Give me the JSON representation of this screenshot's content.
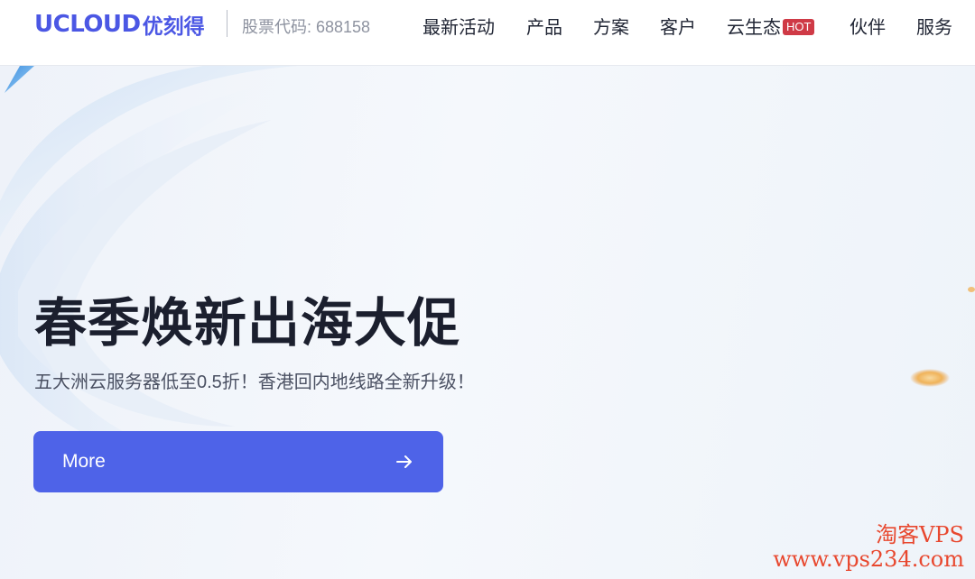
{
  "header": {
    "logo_en": "UCLOUD",
    "logo_cn": "优刻得",
    "stock_code": "股票代码: 688158",
    "nav": [
      {
        "label": "最新活动"
      },
      {
        "label": "产品"
      },
      {
        "label": "方案"
      },
      {
        "label": "客户"
      },
      {
        "label": "云生态",
        "badge": "HOT"
      },
      {
        "label": "伙伴"
      },
      {
        "label": "服务"
      }
    ]
  },
  "hero": {
    "title": "春季焕新出海大促",
    "subtitle": "五大洲云服务器低至0.5折！香港回内地线路全新升级！",
    "cta_label": "More"
  },
  "watermark": {
    "line1": "淘客VPS",
    "line2": "www.vps234.com"
  },
  "colors": {
    "brand": "#4b57e4",
    "cta": "#4e63e8",
    "hot_badge": "#cf3a46",
    "watermark": "#e8482f"
  },
  "icons": {
    "cta_icon": "arrow-right-icon"
  }
}
